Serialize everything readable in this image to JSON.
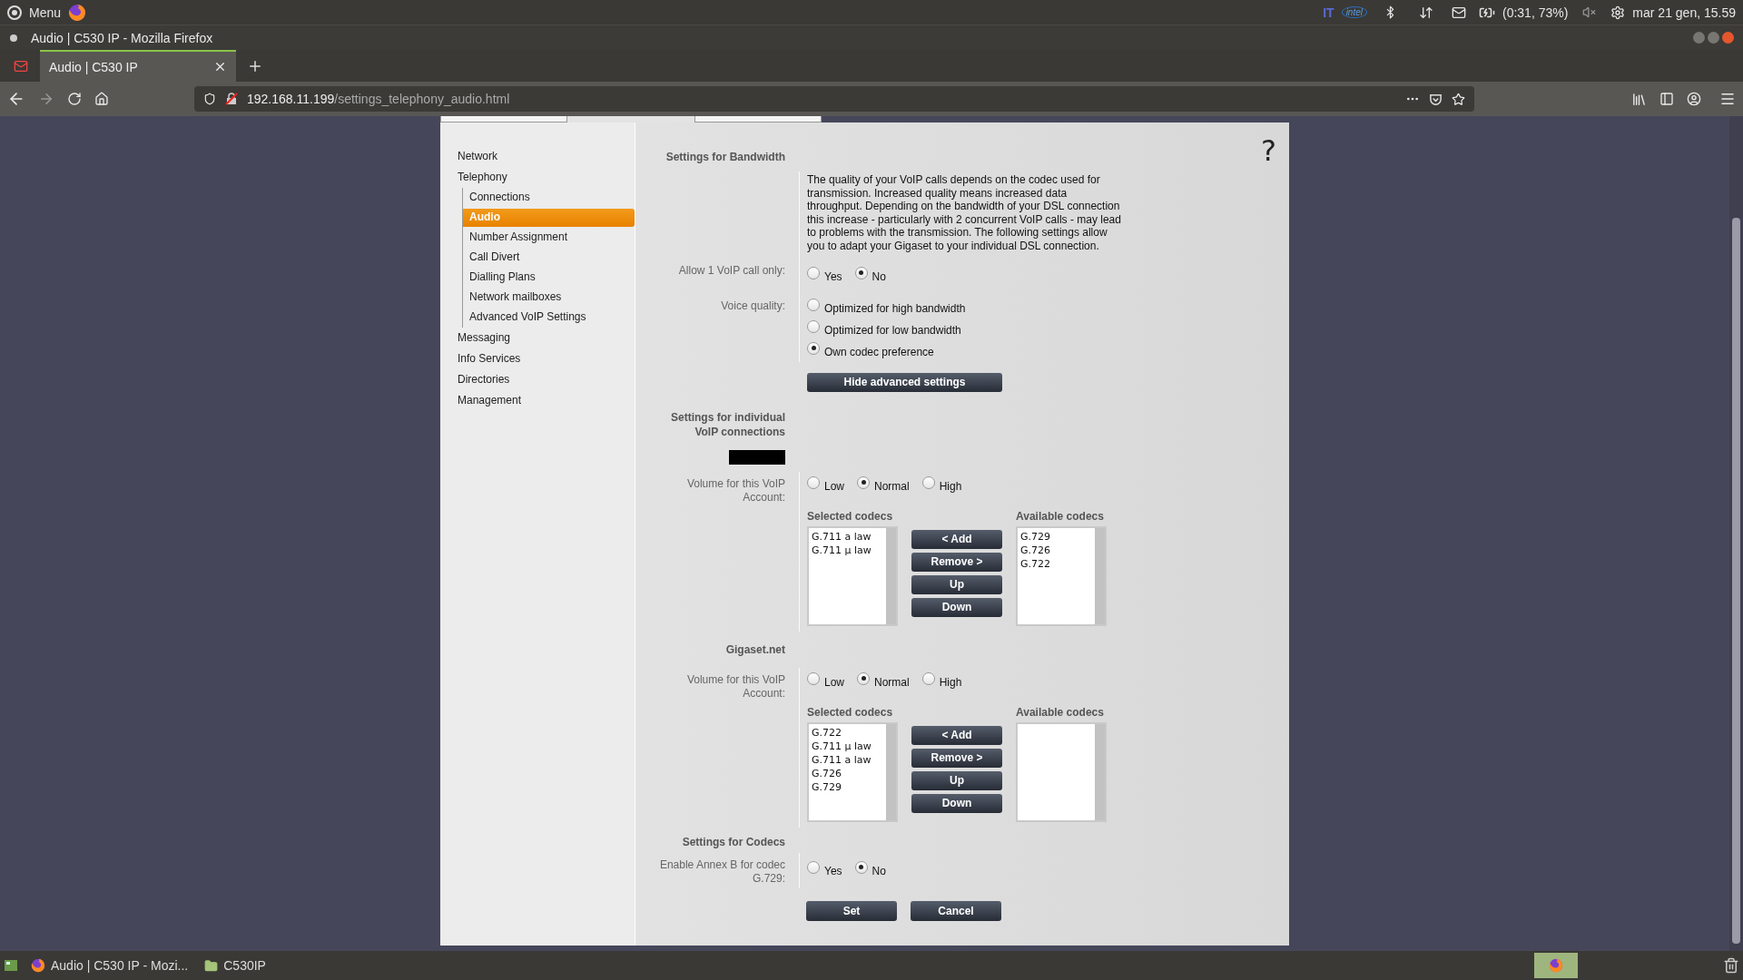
{
  "panel": {
    "menu": "Menu",
    "keyboard": "IT",
    "cpu_logo": "intel",
    "battery": "(0:31, 73%)",
    "clock": "mar 21 gen, 15.59"
  },
  "window": {
    "title": "Audio | C530 IP - Mozilla Firefox"
  },
  "tabs": [
    {
      "label": "Audio | C530 IP",
      "selected": true
    }
  ],
  "address_bar": {
    "host": "192.168.11.199",
    "path": "/settings_telephony_audio.html"
  },
  "page_tabs": [
    {
      "selected": false
    },
    {
      "selected": true
    },
    {
      "selected": false
    }
  ],
  "sidebar": {
    "items": [
      {
        "label": "Network",
        "selected": false
      },
      {
        "label": "Telephony",
        "selected": false,
        "children": [
          {
            "label": "Connections",
            "selected": false
          },
          {
            "label": "Audio",
            "selected": true
          },
          {
            "label": "Number Assignment",
            "selected": false
          },
          {
            "label": "Call Divert",
            "selected": false
          },
          {
            "label": "Dialling Plans",
            "selected": false
          },
          {
            "label": "Network mailboxes",
            "selected": false
          },
          {
            "label": "Advanced VoIP Settings",
            "selected": false
          }
        ]
      },
      {
        "label": "Messaging",
        "selected": false
      },
      {
        "label": "Info Services",
        "selected": false
      },
      {
        "label": "Directories",
        "selected": false
      },
      {
        "label": "Management",
        "selected": false
      }
    ]
  },
  "help": "?",
  "bandwidth": {
    "title": "Settings for Bandwidth",
    "description": "The quality of your VoIP calls depends on the codec used for transmission. Increased quality means increased data throughput. Depending on the bandwidth of your DSL connection this increase - particularly with 2 concurrent VoIP calls - may lead to problems with the transmission. The following settings allow you to adapt your Gigaset to your individual DSL connection.",
    "rows": [
      {
        "label": "Allow 1 VoIP call only:",
        "kind": "inline",
        "options": [
          {
            "label": "Yes",
            "selected": false
          },
          {
            "label": "No",
            "selected": true
          }
        ]
      },
      {
        "label": "Voice quality:",
        "kind": "stacked",
        "options": [
          {
            "label": "Optimized for high bandwidth",
            "selected": false
          },
          {
            "label": "Optimized for low bandwidth",
            "selected": false
          },
          {
            "label": "Own codec preference",
            "selected": true
          }
        ]
      }
    ],
    "toggle_button": "Hide advanced settings"
  },
  "connections": {
    "title": "Settings for individual VoIP connections",
    "accounts": [
      {
        "name_redacted": true,
        "volume": {
          "label": "Volume for this VoIP Account:",
          "options": [
            {
              "label": "Low",
              "selected": false
            },
            {
              "label": "Normal",
              "selected": true
            },
            {
              "label": "High",
              "selected": false
            }
          ]
        },
        "selected_codecs": {
          "heading": "Selected codecs",
          "items": [
            "G.711 a law",
            "G.711 μ law"
          ]
        },
        "available_codecs": {
          "heading": "Available codecs",
          "items": [
            "G.729",
            "G.726",
            "G.722"
          ]
        },
        "buttons": [
          "< Add",
          "Remove >",
          "Up",
          "Down"
        ]
      },
      {
        "name": "Gigaset.net",
        "volume": {
          "label": "Volume for this VoIP Account:",
          "options": [
            {
              "label": "Low",
              "selected": false
            },
            {
              "label": "Normal",
              "selected": true
            },
            {
              "label": "High",
              "selected": false
            }
          ]
        },
        "selected_codecs": {
          "heading": "Selected codecs",
          "items": [
            "G.722",
            "G.711 μ law",
            "G.711 a law",
            "G.726",
            "G.729"
          ]
        },
        "available_codecs": {
          "heading": "Available codecs"
        },
        "buttons": [
          "< Add",
          "Remove >",
          "Up",
          "Down"
        ]
      }
    ]
  },
  "codecs": {
    "title": "Settings for Codecs",
    "rows": [
      {
        "label": "Enable Annex B for codec G.729:",
        "kind": "inline",
        "options": [
          {
            "label": "Yes",
            "selected": false
          },
          {
            "label": "No",
            "selected": true
          }
        ]
      }
    ]
  },
  "actions": [
    "Set",
    "Cancel"
  ],
  "taskbar": {
    "items": [
      {
        "kind": "browser",
        "label": "Audio | C530 IP - Mozi..."
      },
      {
        "kind": "folder",
        "label": "C530IP"
      }
    ]
  }
}
